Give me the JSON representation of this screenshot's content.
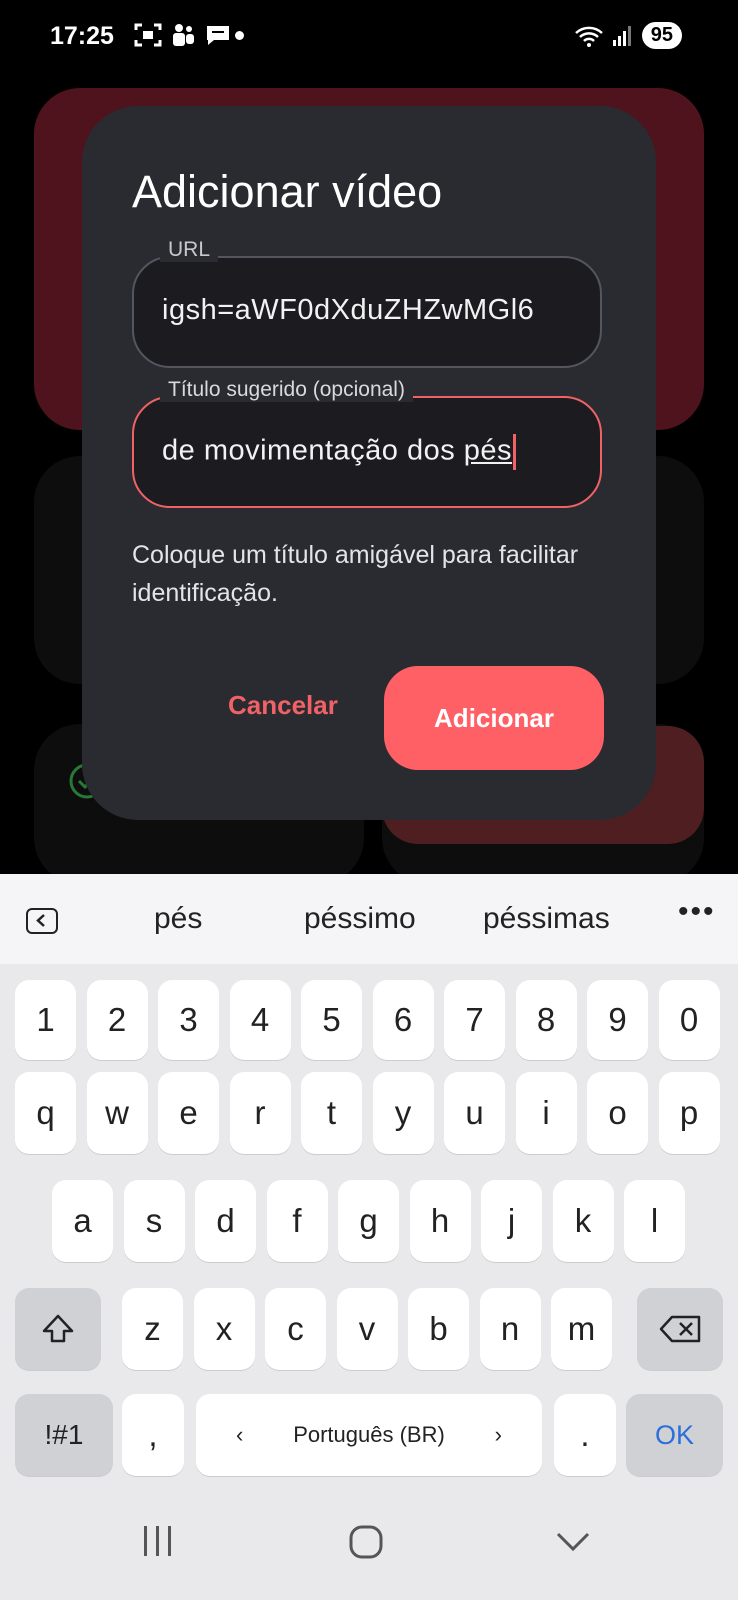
{
  "status_bar": {
    "time": "17:25",
    "battery": "95"
  },
  "dialog": {
    "title": "Adicionar vídeo",
    "url_field": {
      "label": "URL",
      "value": "igsh=aWF0dXduZHZwMGl6"
    },
    "title_field": {
      "label": "Título sugerido (opcional)",
      "value_prefix": "de movimentação dos ",
      "value_current_word": "pés"
    },
    "helper_text": "Coloque um título amigável para facilitar identificação.",
    "cancel_label": "Cancelar",
    "confirm_label": "Adicionar"
  },
  "keyboard": {
    "suggestions": [
      "pés",
      "péssimo",
      "péssimas"
    ],
    "number_row": [
      "1",
      "2",
      "3",
      "4",
      "5",
      "6",
      "7",
      "8",
      "9",
      "0"
    ],
    "row1": [
      "q",
      "w",
      "e",
      "r",
      "t",
      "y",
      "u",
      "i",
      "o",
      "p"
    ],
    "row2": [
      "a",
      "s",
      "d",
      "f",
      "g",
      "h",
      "j",
      "k",
      "l"
    ],
    "row3": [
      "z",
      "x",
      "c",
      "v",
      "b",
      "n",
      "m"
    ],
    "symbols_label": "!#1",
    "comma_label": ",",
    "language_label": "Português (BR)",
    "period_label": ".",
    "ok_label": "OK"
  },
  "colors": {
    "accent": "#ff6066",
    "dialog_bg": "#2a2b31",
    "field_bg": "#1c1c20"
  }
}
